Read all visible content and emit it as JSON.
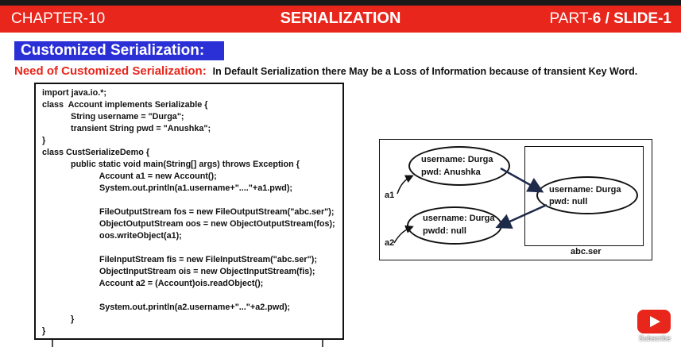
{
  "header": {
    "chapter": "CHAPTER-10",
    "title": "SERIALIZATION",
    "part_prefix": "PART-",
    "part_number": "6",
    "slide_sep": " / SLIDE-",
    "slide_number": "1"
  },
  "heading": "Customized Serialization:",
  "need": {
    "label": "Need of Customized Serialization:",
    "text": "In Default Serialization there May be a Loss of Information because of transient  Key Word."
  },
  "code_lines": [
    "import java.io.*;",
    "class  Account implements Serializable {",
    "            String username = \"Durga\";",
    "            transient String pwd = \"Anushka\";",
    "}",
    "class CustSerializeDemo {",
    "            public static void main(String[] args) throws Exception {",
    "                        Account a1 = new Account();",
    "                        System.out.println(a1.username+\"....\"+a1.pwd);",
    "",
    "                        FileOutputStream fos = new FileOutputStream(\"abc.ser\");",
    "                        ObjectOutputStream oos = new ObjectOutputStream(fos);",
    "                        oos.writeObject(a1);",
    "",
    "                        FileInputStream fis = new FileInputStream(\"abc.ser\");",
    "                        ObjectInputStream ois = new ObjectInputStream(fis);",
    "                        Account a2 = (Account)ois.readObject();",
    "",
    "                        System.out.println(a2.username+\"...\"+a2.pwd);",
    "            }",
    "}"
  ],
  "diagram": {
    "a1": {
      "ref": "a1",
      "username": "username: Durga",
      "pwd": "pwd:  Anushka"
    },
    "a2": {
      "ref": "a2",
      "username": "username: Durga",
      "pwd": "pwdd:  null"
    },
    "file_obj": {
      "username": "username: Durga",
      "pwd": "pwd:  null"
    },
    "file_name": "abc.ser"
  },
  "subscribe": "Subscribe",
  "colors": {
    "header_red": "#e8261b",
    "heading_blue": "#2b2fd6"
  }
}
